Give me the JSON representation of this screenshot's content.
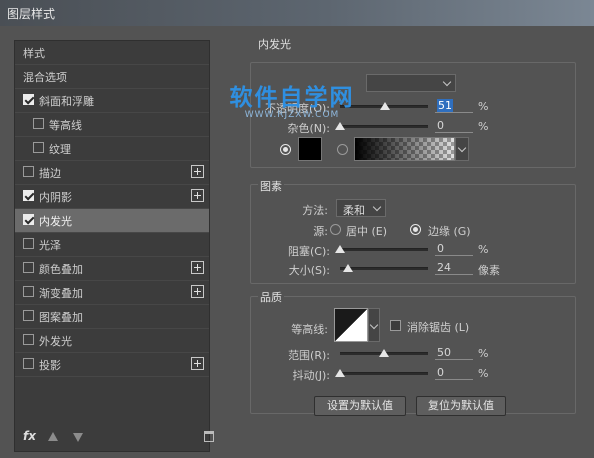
{
  "window": {
    "title": "图层样式"
  },
  "left_panel": {
    "header_styles": "样式",
    "header_blend": "混合选项",
    "items": [
      {
        "label": "斜面和浮雕",
        "checked": true,
        "indent": false,
        "plus": false
      },
      {
        "label": "等高线",
        "checked": false,
        "indent": true,
        "plus": false
      },
      {
        "label": "纹理",
        "checked": false,
        "indent": true,
        "plus": false
      },
      {
        "label": "描边",
        "checked": false,
        "indent": false,
        "plus": true
      },
      {
        "label": "内阴影",
        "checked": true,
        "indent": false,
        "plus": true
      },
      {
        "label": "内发光",
        "checked": true,
        "indent": false,
        "plus": false,
        "selected": true
      },
      {
        "label": "光泽",
        "checked": false,
        "indent": false,
        "plus": false
      },
      {
        "label": "颜色叠加",
        "checked": false,
        "indent": false,
        "plus": true
      },
      {
        "label": "渐变叠加",
        "checked": false,
        "indent": false,
        "plus": true
      },
      {
        "label": "图案叠加",
        "checked": false,
        "indent": false,
        "plus": false
      },
      {
        "label": "外发光",
        "checked": false,
        "indent": false,
        "plus": false
      },
      {
        "label": "投影",
        "checked": false,
        "indent": false,
        "plus": true
      }
    ],
    "footer_fx": "fx"
  },
  "inner_glow": {
    "title": "内发光",
    "opacity_label": "不透明度(O):",
    "opacity_value": "51",
    "opacity_unit": "%",
    "opacity_level": 0.51,
    "noise_label": "杂色(N):",
    "noise_value": "0",
    "noise_unit": "%",
    "noise_level": 0
  },
  "elements": {
    "title": "图素",
    "method_label": "方法:",
    "method_value": "柔和",
    "source_label": "源:",
    "source_center": "居中 (E)",
    "source_edge": "边缘 (G)",
    "choke_label": "阻塞(C):",
    "choke_value": "0",
    "choke_unit": "%",
    "choke_level": 0,
    "size_label": "大小(S):",
    "size_value": "24",
    "size_unit": "像素",
    "size_level": 0.096
  },
  "quality": {
    "title": "品质",
    "contour_label": "等高线:",
    "antialias_label": "消除锯齿 (L)",
    "range_label": "范围(R):",
    "range_value": "50",
    "range_unit": "%",
    "range_level": 0.5,
    "jitter_label": "抖动(J):",
    "jitter_value": "0",
    "jitter_unit": "%",
    "jitter_level": 0
  },
  "buttons": {
    "make_default": "设置为默认值",
    "reset_default": "复位为默认值"
  },
  "watermark": {
    "main": "软件自学网",
    "sub": "WWW.RJZXW.COM"
  },
  "colors": {
    "glow_color": "#000000",
    "selection": "#6b6b6b",
    "watermark": "#2f8fe0"
  }
}
